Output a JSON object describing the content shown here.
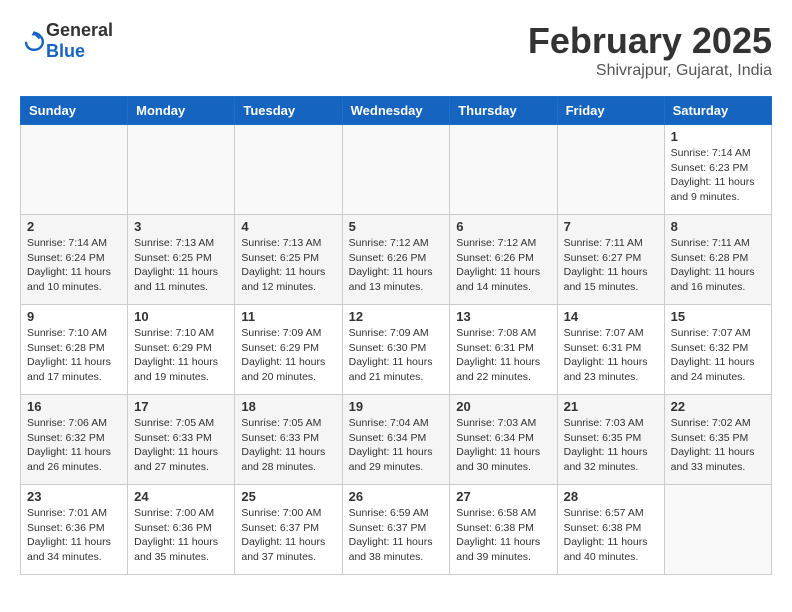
{
  "logo": {
    "general": "General",
    "blue": "Blue"
  },
  "title": {
    "month_year": "February 2025",
    "location": "Shivrajpur, Gujarat, India"
  },
  "weekdays": [
    "Sunday",
    "Monday",
    "Tuesday",
    "Wednesday",
    "Thursday",
    "Friday",
    "Saturday"
  ],
  "weeks": [
    [
      {
        "day": "",
        "info": ""
      },
      {
        "day": "",
        "info": ""
      },
      {
        "day": "",
        "info": ""
      },
      {
        "day": "",
        "info": ""
      },
      {
        "day": "",
        "info": ""
      },
      {
        "day": "",
        "info": ""
      },
      {
        "day": "1",
        "info": "Sunrise: 7:14 AM\nSunset: 6:23 PM\nDaylight: 11 hours\nand 9 minutes."
      }
    ],
    [
      {
        "day": "2",
        "info": "Sunrise: 7:14 AM\nSunset: 6:24 PM\nDaylight: 11 hours\nand 10 minutes."
      },
      {
        "day": "3",
        "info": "Sunrise: 7:13 AM\nSunset: 6:25 PM\nDaylight: 11 hours\nand 11 minutes."
      },
      {
        "day": "4",
        "info": "Sunrise: 7:13 AM\nSunset: 6:25 PM\nDaylight: 11 hours\nand 12 minutes."
      },
      {
        "day": "5",
        "info": "Sunrise: 7:12 AM\nSunset: 6:26 PM\nDaylight: 11 hours\nand 13 minutes."
      },
      {
        "day": "6",
        "info": "Sunrise: 7:12 AM\nSunset: 6:26 PM\nDaylight: 11 hours\nand 14 minutes."
      },
      {
        "day": "7",
        "info": "Sunrise: 7:11 AM\nSunset: 6:27 PM\nDaylight: 11 hours\nand 15 minutes."
      },
      {
        "day": "8",
        "info": "Sunrise: 7:11 AM\nSunset: 6:28 PM\nDaylight: 11 hours\nand 16 minutes."
      }
    ],
    [
      {
        "day": "9",
        "info": "Sunrise: 7:10 AM\nSunset: 6:28 PM\nDaylight: 11 hours\nand 17 minutes."
      },
      {
        "day": "10",
        "info": "Sunrise: 7:10 AM\nSunset: 6:29 PM\nDaylight: 11 hours\nand 19 minutes."
      },
      {
        "day": "11",
        "info": "Sunrise: 7:09 AM\nSunset: 6:29 PM\nDaylight: 11 hours\nand 20 minutes."
      },
      {
        "day": "12",
        "info": "Sunrise: 7:09 AM\nSunset: 6:30 PM\nDaylight: 11 hours\nand 21 minutes."
      },
      {
        "day": "13",
        "info": "Sunrise: 7:08 AM\nSunset: 6:31 PM\nDaylight: 11 hours\nand 22 minutes."
      },
      {
        "day": "14",
        "info": "Sunrise: 7:07 AM\nSunset: 6:31 PM\nDaylight: 11 hours\nand 23 minutes."
      },
      {
        "day": "15",
        "info": "Sunrise: 7:07 AM\nSunset: 6:32 PM\nDaylight: 11 hours\nand 24 minutes."
      }
    ],
    [
      {
        "day": "16",
        "info": "Sunrise: 7:06 AM\nSunset: 6:32 PM\nDaylight: 11 hours\nand 26 minutes."
      },
      {
        "day": "17",
        "info": "Sunrise: 7:05 AM\nSunset: 6:33 PM\nDaylight: 11 hours\nand 27 minutes."
      },
      {
        "day": "18",
        "info": "Sunrise: 7:05 AM\nSunset: 6:33 PM\nDaylight: 11 hours\nand 28 minutes."
      },
      {
        "day": "19",
        "info": "Sunrise: 7:04 AM\nSunset: 6:34 PM\nDaylight: 11 hours\nand 29 minutes."
      },
      {
        "day": "20",
        "info": "Sunrise: 7:03 AM\nSunset: 6:34 PM\nDaylight: 11 hours\nand 30 minutes."
      },
      {
        "day": "21",
        "info": "Sunrise: 7:03 AM\nSunset: 6:35 PM\nDaylight: 11 hours\nand 32 minutes."
      },
      {
        "day": "22",
        "info": "Sunrise: 7:02 AM\nSunset: 6:35 PM\nDaylight: 11 hours\nand 33 minutes."
      }
    ],
    [
      {
        "day": "23",
        "info": "Sunrise: 7:01 AM\nSunset: 6:36 PM\nDaylight: 11 hours\nand 34 minutes."
      },
      {
        "day": "24",
        "info": "Sunrise: 7:00 AM\nSunset: 6:36 PM\nDaylight: 11 hours\nand 35 minutes."
      },
      {
        "day": "25",
        "info": "Sunrise: 7:00 AM\nSunset: 6:37 PM\nDaylight: 11 hours\nand 37 minutes."
      },
      {
        "day": "26",
        "info": "Sunrise: 6:59 AM\nSunset: 6:37 PM\nDaylight: 11 hours\nand 38 minutes."
      },
      {
        "day": "27",
        "info": "Sunrise: 6:58 AM\nSunset: 6:38 PM\nDaylight: 11 hours\nand 39 minutes."
      },
      {
        "day": "28",
        "info": "Sunrise: 6:57 AM\nSunset: 6:38 PM\nDaylight: 11 hours\nand 40 minutes."
      },
      {
        "day": "",
        "info": ""
      }
    ]
  ]
}
